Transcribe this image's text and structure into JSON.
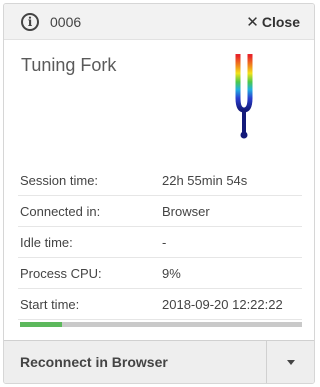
{
  "header": {
    "session_id": "0006",
    "close_label": "Close",
    "info_icon": "info-circle-icon",
    "close_icon": "x-icon"
  },
  "app": {
    "title": "Tuning Fork",
    "icon": "tuning-fork-icon"
  },
  "details": [
    {
      "label": "Session time:",
      "value": "22h 55min 54s"
    },
    {
      "label": "Connected in:",
      "value": "Browser"
    },
    {
      "label": "Idle time:",
      "value": "-"
    },
    {
      "label": "Process CPU:",
      "value": "9%"
    },
    {
      "label": "Start time:",
      "value": "2018-09-20 12:22:22"
    }
  ],
  "progress": {
    "percent": 15,
    "color": "#5cb85c"
  },
  "footer": {
    "reconnect_label": "Reconnect in Browser",
    "dropdown_icon": "caret-down-icon"
  }
}
